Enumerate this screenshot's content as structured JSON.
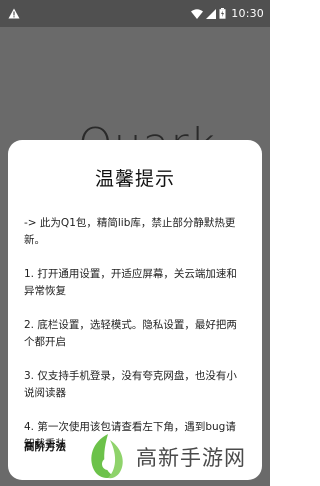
{
  "status_bar": {
    "time": "10:30"
  },
  "background": {
    "logo_text": "Quark"
  },
  "dialog": {
    "title": "温馨提示",
    "items": [
      "-> 此为Q1包，精简lib库，禁止部分静默热更新。",
      "1. 打开通用设置，开适应屏幕，关云端加速和异常恢复",
      "2. 底栏设置，选轻模式。隐私设置，最好把两个都开启",
      "3. 仅支持手机登录，没有夸克网盘，也没有小说阅读器",
      "4. 第一次使用该包请查看左下角，遇到bug请卸载重装"
    ],
    "advanced_link": "高阶方法"
  },
  "watermark": {
    "text": "高新手游网"
  },
  "colors": {
    "scrim": "#5f5f5f",
    "dialog_bg": "#ffffff",
    "watermark_green": "#6cc24a"
  }
}
